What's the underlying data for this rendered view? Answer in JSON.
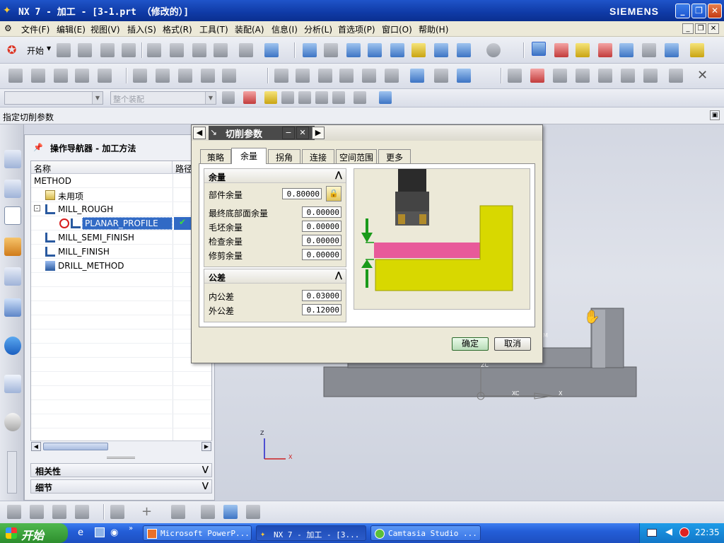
{
  "titlebar": {
    "title": "NX 7 - 加工 - [3-1.prt （修改的）]",
    "brand": "SIEMENS",
    "minimize_icon": "minimize-icon",
    "restore_icon": "restore-icon",
    "close_icon": "close-icon"
  },
  "menubar": {
    "items": [
      "文件(F)",
      "编辑(E)",
      "视图(V)",
      "插入(S)",
      "格式(R)",
      "工具(T)",
      "装配(A)",
      "信息(I)",
      "分析(L)",
      "首选项(P)",
      "窗口(O)",
      "帮助(H)"
    ]
  },
  "toolbar": {
    "start_label": "开始",
    "filter_combo": "",
    "assembly_combo": "整个装配"
  },
  "cue": {
    "text": "指定切削参数"
  },
  "navigator": {
    "title": "操作导航器 - 加工方法",
    "col_name": "名称",
    "col_path": "路径",
    "rows": [
      {
        "label": "METHOD",
        "indent": 0
      },
      {
        "label": "未用项",
        "indent": 1
      },
      {
        "label": "MILL_ROUGH",
        "indent": 1
      },
      {
        "label": "PLANAR_PROFILE",
        "indent": 2,
        "selected": true
      },
      {
        "label": "MILL_SEMI_FINISH",
        "indent": 1
      },
      {
        "label": "MILL_FINISH",
        "indent": 1
      },
      {
        "label": "DRILL_METHOD",
        "indent": 1
      }
    ],
    "sections": [
      "相关性",
      "细节"
    ]
  },
  "dialog": {
    "title": "切削参数",
    "tabs": [
      "策略",
      "余量",
      "拐角",
      "连接",
      "空间范围",
      "更多"
    ],
    "active_tab": "余量",
    "stock_group": {
      "title": "余量",
      "fields": [
        {
          "label": "部件余量",
          "value": "0.80000"
        },
        {
          "label": "最终底部面余量",
          "value": "0.00000"
        },
        {
          "label": "毛坯余量",
          "value": "0.00000"
        },
        {
          "label": "检查余量",
          "value": "0.00000"
        },
        {
          "label": "修剪余量",
          "value": "0.00000"
        }
      ]
    },
    "tolerance_group": {
      "title": "公差",
      "fields": [
        {
          "label": "内公差",
          "value": "0.03000"
        },
        {
          "label": "外公差",
          "value": "0.12000"
        }
      ]
    },
    "ok_label": "确定",
    "cancel_label": "取消"
  },
  "viewport": {
    "axis_z": "Z",
    "axis_x": "X",
    "axis_zc": "ZC",
    "axis_xc": "XC",
    "axis_x2": "X",
    "label_m": "M"
  },
  "taskbar": {
    "start": "开始",
    "tasks": [
      "Microsoft PowerP...",
      "NX 7 - 加工 - [3...",
      "Camtasia Studio ..."
    ],
    "clock": "22:35"
  },
  "colors": {
    "part_yellow": "#d8d800",
    "stock_pink": "#e85a9a",
    "arrow_green": "#1a9a1a",
    "selection_blue": "#316ac5"
  }
}
